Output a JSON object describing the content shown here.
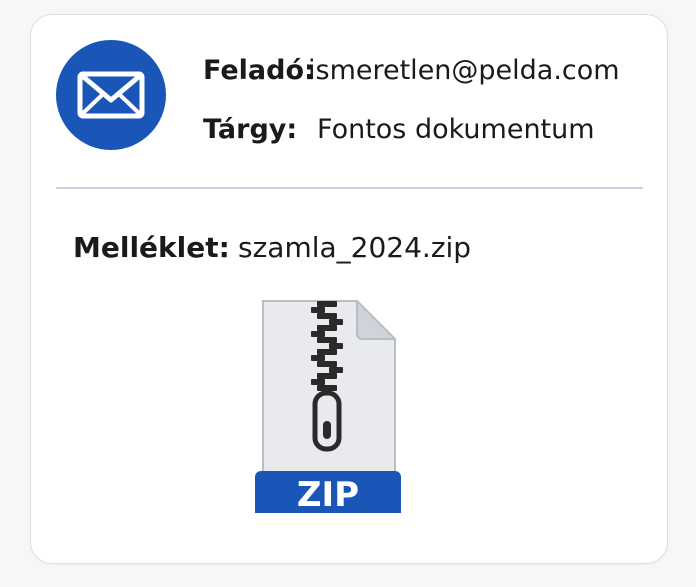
{
  "email": {
    "sender_label": "Feladó:",
    "sender_value": "ismeretlen@pelda.com",
    "subject_label": "Tárgy:",
    "subject_value": "Fontos dokumentum",
    "attachment_label": "Melléklet:",
    "attachment_value": "szamla_2024.zip",
    "file_type_label": "ZIP"
  },
  "icons": {
    "avatar": "envelope-icon",
    "attachment": "zip-file-icon"
  },
  "colors": {
    "accent": "#1a56b8",
    "divider": "#c9d2df",
    "file_body": "#e8eaee"
  }
}
